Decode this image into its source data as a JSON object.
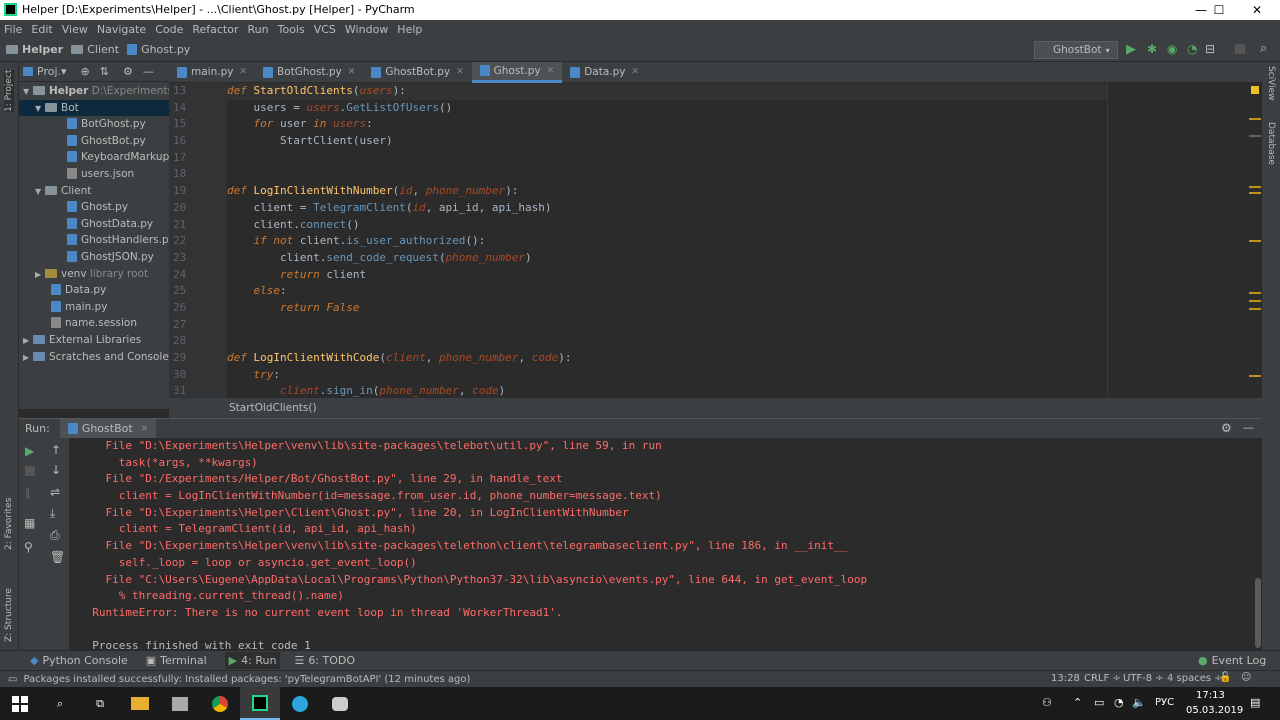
{
  "window": {
    "title": "Helper [D:\\Experiments\\Helper] - ...\\Client\\Ghost.py [Helper] - PyCharm"
  },
  "menu": [
    "File",
    "Edit",
    "View",
    "Navigate",
    "Code",
    "Refactor",
    "Run",
    "Tools",
    "VCS",
    "Window",
    "Help"
  ],
  "nav": {
    "crumbs": [
      "Helper",
      "Client",
      "Ghost.py"
    ],
    "run_config": "GhostBot"
  },
  "project": {
    "tab_label": "Proj.▾",
    "items": [
      {
        "label": "Helper",
        "extra": "D:\\Experiments\\He",
        "type": "root"
      },
      {
        "label": "Bot",
        "type": "folder",
        "sel": true
      },
      {
        "label": "BotGhost.py",
        "type": "py"
      },
      {
        "label": "GhostBot.py",
        "type": "py"
      },
      {
        "label": "KeyboardMarkups.p",
        "type": "py"
      },
      {
        "label": "users.json",
        "type": "json"
      },
      {
        "label": "Client",
        "type": "folder"
      },
      {
        "label": "Ghost.py",
        "type": "py"
      },
      {
        "label": "GhostData.py",
        "type": "py"
      },
      {
        "label": "GhostHandlers.py",
        "type": "py"
      },
      {
        "label": "GhostJSON.py",
        "type": "py"
      },
      {
        "label": "venv",
        "extra": "library root",
        "type": "folder"
      },
      {
        "label": "Data.py",
        "type": "py"
      },
      {
        "label": "main.py",
        "type": "py"
      },
      {
        "label": "name.session",
        "type": "file"
      },
      {
        "label": "External Libraries",
        "type": "lib"
      },
      {
        "label": "Scratches and Consoles",
        "type": "lib"
      }
    ]
  },
  "tabs": [
    "main.py",
    "BotGhost.py",
    "GhostBot.py",
    "Ghost.py",
    "Data.py"
  ],
  "active_tab": "Ghost.py",
  "editor": {
    "lines": [
      "13",
      "14",
      "15",
      "16",
      "17",
      "18",
      "19",
      "20",
      "21",
      "22",
      "23",
      "24",
      "25",
      "26",
      "27",
      "28",
      "29",
      "30",
      "31"
    ],
    "breadcrumb": "StartOldClients()"
  },
  "run": {
    "label": "Run:",
    "config": "GhostBot"
  },
  "console": [
    "    File \"D:\\Experiments\\Helper\\venv\\lib\\site-packages\\telebot\\util.py\", line 59, in run",
    "      task(*args, **kwargs)",
    "    File \"D:/Experiments/Helper/Bot/GhostBot.py\", line 29, in handle_text",
    "      client = LogInClientWithNumber(id=message.from_user.id, phone_number=message.text)",
    "    File \"D:\\Experiments\\Helper\\Client\\Ghost.py\", line 20, in LogInClientWithNumber",
    "      client = TelegramClient(id, api_id, api_hash)",
    "    File \"D:\\Experiments\\Helper\\venv\\lib\\site-packages\\telethon\\client\\telegrambaseclient.py\", line 186, in __init__",
    "      self._loop = loop or asyncio.get_event_loop()",
    "    File \"C:\\Users\\Eugene\\AppData\\Local\\Programs\\Python\\Python37-32\\lib\\asyncio\\events.py\", line 644, in get_event_loop",
    "      % threading.current_thread().name)",
    "  RuntimeError: There is no current event loop in thread 'WorkerThread1'.",
    "",
    "  Process finished with exit code 1"
  ],
  "bottom_tabs": [
    "Python Console",
    "Terminal",
    "4: Run",
    "6: TODO"
  ],
  "event_log": "Event Log",
  "status": {
    "message": "Packages installed successfully: Installed packages: 'pyTelegramBotAPI' (12 minutes ago)",
    "pos": "13:28",
    "crlf": "CRLF ÷",
    "enc": "UTF-8 ÷",
    "indent": "4 spaces ÷"
  },
  "side": {
    "left": [
      "1: Project",
      "2: Favorites",
      "Z: Structure"
    ],
    "right": [
      "SciView",
      "Database"
    ]
  },
  "taskbar": {
    "lang": "РУС",
    "time": "17:13",
    "date": "05.03.2019"
  }
}
